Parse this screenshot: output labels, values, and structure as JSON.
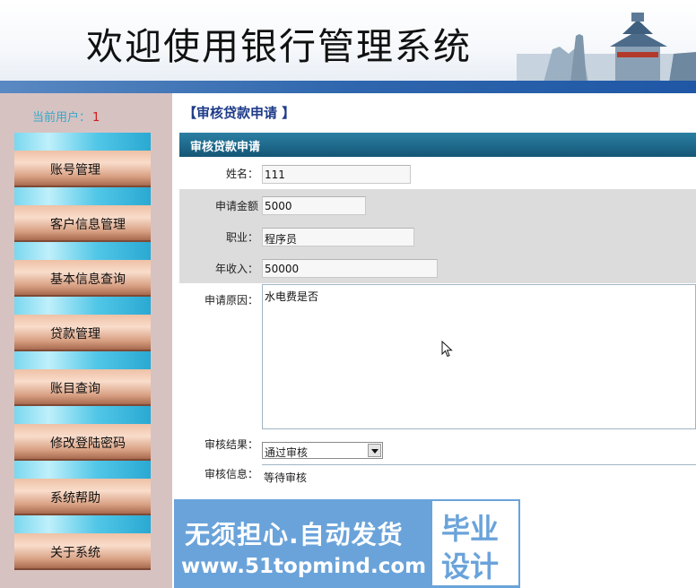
{
  "banner": {
    "title": "欢迎使用银行管理系统"
  },
  "sidebar": {
    "user_label": "当前用户：",
    "user_value": "1",
    "items": [
      {
        "label": "账号管理"
      },
      {
        "label": "客户信息管理"
      },
      {
        "label": "基本信息查询"
      },
      {
        "label": "贷款管理"
      },
      {
        "label": "账目查询"
      },
      {
        "label": "修改登陆密码"
      },
      {
        "label": "系统帮助"
      },
      {
        "label": "关于系统"
      }
    ]
  },
  "main": {
    "page_title": "【审核贷款申请 】",
    "form_header": "审核贷款申请",
    "fields": {
      "name": {
        "label": "姓名：",
        "value": "111"
      },
      "amount": {
        "label": "申请金额",
        "value": "5000"
      },
      "job": {
        "label": "职业：",
        "value": "程序员"
      },
      "income": {
        "label": "年收入：",
        "value": "50000"
      },
      "reason": {
        "label": "申请原因：",
        "value": "水电费是否"
      },
      "result": {
        "label": "审核结果：",
        "value": "通过审核"
      },
      "info": {
        "label": "审核信息：",
        "value": "等待审核"
      }
    }
  },
  "ad": {
    "line1": "无须担心.自动发货",
    "line2": "www.51topmind.com",
    "badge1": "毕业",
    "badge2": "设计"
  },
  "colors": {
    "banner_stripe": "#2f66ad",
    "sidebar_bg": "#d7c2c2",
    "form_header": "#1d6789",
    "page_title": "#1f3c8a",
    "user_label": "#35a8c9",
    "user_value": "#d11a1a"
  },
  "icons": {
    "select_arrow": "chevron-down-icon",
    "cursor": "mouse-pointer-icon"
  }
}
